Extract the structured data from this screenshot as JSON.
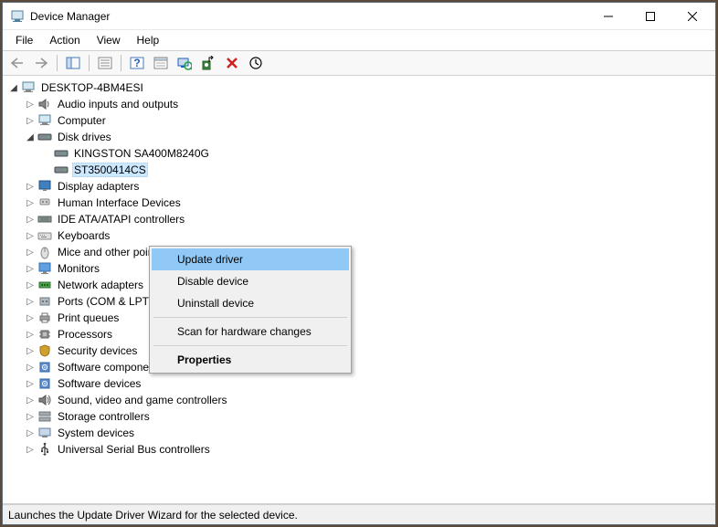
{
  "window": {
    "title": "Device Manager"
  },
  "menubar": [
    "File",
    "Action",
    "View",
    "Help"
  ],
  "tree": {
    "root": "DESKTOP-4BM4ESI",
    "categories": [
      {
        "label": "Audio inputs and outputs",
        "expanded": false
      },
      {
        "label": "Computer",
        "expanded": false
      },
      {
        "label": "Disk drives",
        "expanded": true,
        "children": [
          "KINGSTON SA400M8240G",
          "ST3500414CS"
        ]
      },
      {
        "label": "Display adapters",
        "expanded": false
      },
      {
        "label": "Human Interface Devices",
        "expanded": false
      },
      {
        "label": "IDE ATA/ATAPI controllers",
        "expanded": false
      },
      {
        "label": "Keyboards",
        "expanded": false
      },
      {
        "label": "Mice and other pointing devices",
        "expanded": false
      },
      {
        "label": "Monitors",
        "expanded": false
      },
      {
        "label": "Network adapters",
        "expanded": false
      },
      {
        "label": "Ports (COM & LPT)",
        "expanded": false
      },
      {
        "label": "Print queues",
        "expanded": false
      },
      {
        "label": "Processors",
        "expanded": false
      },
      {
        "label": "Security devices",
        "expanded": false
      },
      {
        "label": "Software components",
        "expanded": false
      },
      {
        "label": "Software devices",
        "expanded": false
      },
      {
        "label": "Sound, video and game controllers",
        "expanded": false
      },
      {
        "label": "Storage controllers",
        "expanded": false
      },
      {
        "label": "System devices",
        "expanded": false
      },
      {
        "label": "Universal Serial Bus controllers",
        "expanded": false
      }
    ],
    "selected": "ST3500414CS"
  },
  "context_menu": {
    "items": [
      {
        "label": "Update driver",
        "highlighted": true
      },
      {
        "label": "Disable device"
      },
      {
        "label": "Uninstall device"
      },
      {
        "sep": true
      },
      {
        "label": "Scan for hardware changes"
      },
      {
        "sep": true
      },
      {
        "label": "Properties",
        "bold": true
      }
    ]
  },
  "statusbar": "Launches the Update Driver Wizard for the selected device."
}
